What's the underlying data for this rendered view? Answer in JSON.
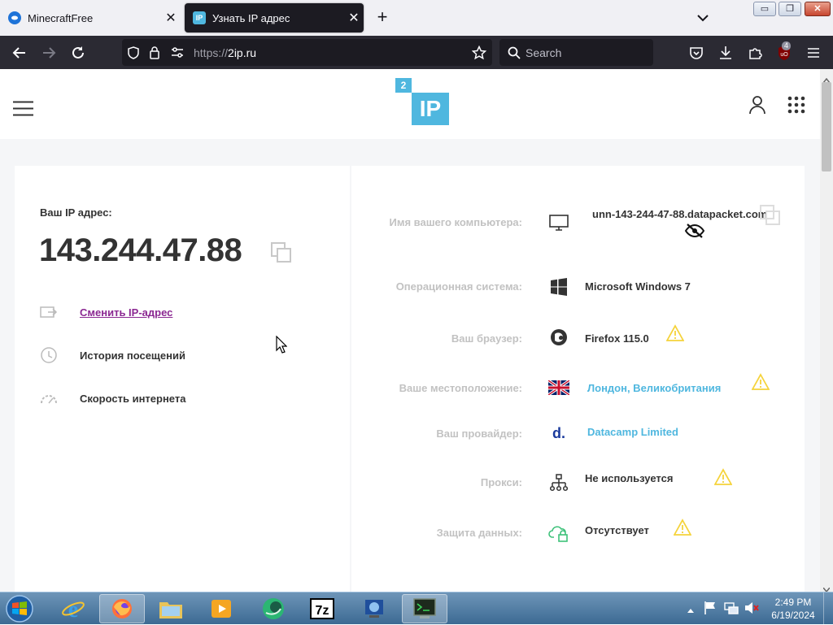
{
  "browser": {
    "tabs": [
      {
        "title": "MinecraftFree",
        "favicon_color": "#1e73d8"
      },
      {
        "title": "Узнать IP адрес",
        "favicon_text": "IP",
        "favicon_color": "#4fb7df"
      }
    ],
    "url_scheme": "https://",
    "url_host": "2ip.ru",
    "search_placeholder": "Search",
    "extension_badge": "4",
    "window_controls": {
      "minimize": "▭",
      "maximize": "❐",
      "close": "✕"
    }
  },
  "site": {
    "logo": {
      "small": "2",
      "big": "IP",
      "color": "#4fb7df"
    },
    "ip_label": "Ваш IP адрес:",
    "ip_value": "143.244.47.88",
    "menu": [
      {
        "label": "Сменить IP-адрес",
        "icon": "change-ip-icon"
      },
      {
        "label": "История посещений",
        "icon": "history-icon"
      },
      {
        "label": "Скорость интернета",
        "icon": "speedometer-icon"
      }
    ],
    "details": [
      {
        "label": "Имя вашего компьютера:",
        "value": "unn-143-244-47-88.datapacket.com",
        "icon": "monitor-icon"
      },
      {
        "label": "Операционная система:",
        "value": "Microsoft Windows 7",
        "icon": "windows-icon"
      },
      {
        "label": "Ваш браузер:",
        "value": "Firefox 115.0",
        "icon": "firefox-icon"
      },
      {
        "label": "Ваше местоположение:",
        "value": "Лондон, Великобритания",
        "icon": "uk-flag-icon"
      },
      {
        "label": "Ваш провайдер:",
        "value": "Datacamp Limited",
        "icon": "provider-icon"
      },
      {
        "label": "Прокси:",
        "value": "Не используется",
        "icon": "proxy-icon"
      },
      {
        "label": "Защита данных:",
        "value": "Отсутствует",
        "icon": "lock-icon"
      }
    ],
    "accent": "#4fb7df",
    "warning_color": "#f5d33b"
  },
  "taskbar": {
    "time": "2:49 PM",
    "date": "6/19/2024"
  }
}
